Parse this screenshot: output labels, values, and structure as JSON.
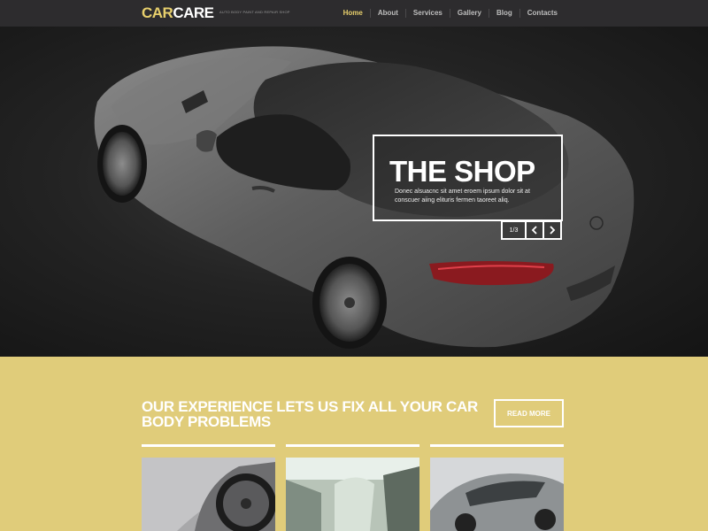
{
  "header": {
    "logo_car": "CAR",
    "logo_care": "CARE",
    "tagline": "AUTO BODY PAINT AND REPAIR SHOP",
    "nav": [
      {
        "label": "Home",
        "active": true
      },
      {
        "label": "About",
        "active": false
      },
      {
        "label": "Services",
        "active": false
      },
      {
        "label": "Gallery",
        "active": false
      },
      {
        "label": "Blog",
        "active": false
      },
      {
        "label": "Contacts",
        "active": false
      }
    ]
  },
  "hero": {
    "title": "THE SHOP",
    "text": "Donec alsuacnc sit amet eroem ipsum dolor sit at conscuer aiing elituris fermen taoreet aliq.",
    "counter": "1/3",
    "prev_icon": "chevron-left-icon",
    "next_icon": "chevron-right-icon"
  },
  "cta": {
    "heading": "OUR EXPERIENCE LETS US FIX ALL YOUR CAR BODY PROBLEMS",
    "button": "READ MORE"
  },
  "gallery": [
    {
      "image": "car-wheel-side-photo"
    },
    {
      "image": "car-interior-seat-photo"
    },
    {
      "image": "silver-sports-car-photo"
    }
  ],
  "colors": {
    "header_bg": "#2d2c2e",
    "accent_yellow": "#e7cf6c",
    "section_bg": "#e0cc7a",
    "white": "#ffffff"
  }
}
